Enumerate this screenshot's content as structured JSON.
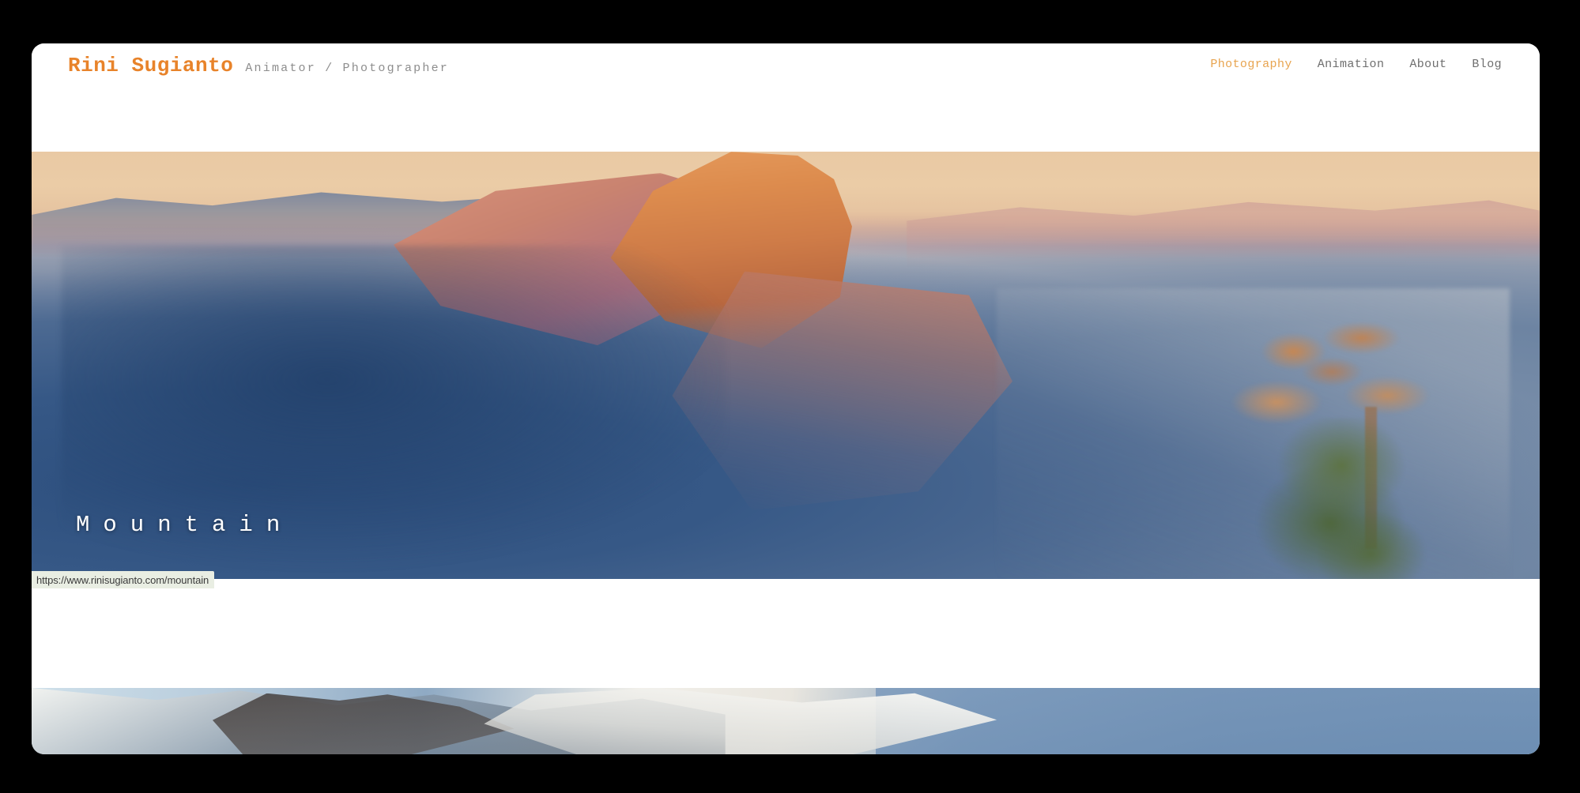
{
  "window": {
    "background_color": "#000000",
    "page_background": "#ffffff"
  },
  "header": {
    "brand_name": "Rini Sugianto",
    "brand_tagline": "Animator / Photographer",
    "brand_color": "#e8832a",
    "tagline_color": "#8d8d8d",
    "nav": [
      {
        "label": "Photography",
        "active": true,
        "color": "#e8a44f"
      },
      {
        "label": "Animation",
        "active": false,
        "color": "#6f6f6f"
      },
      {
        "label": "About",
        "active": false,
        "color": "#6f6f6f"
      },
      {
        "label": "Blog",
        "active": false,
        "color": "#6f6f6f"
      }
    ]
  },
  "gallery": {
    "hero": {
      "caption": "Mountain",
      "caption_color": "#ffffff",
      "alt": "Half Dome at sunset over Yosemite Valley with alpenglow on granite peaks and a pine tree in the foreground"
    },
    "next": {
      "alt": "Snow covered mountain ridge against a blue sky"
    }
  },
  "status_bar": {
    "url": "https://www.rinisugianto.com/mountain",
    "background_color": "#e9eee3",
    "text_color": "#3b3b3b"
  }
}
